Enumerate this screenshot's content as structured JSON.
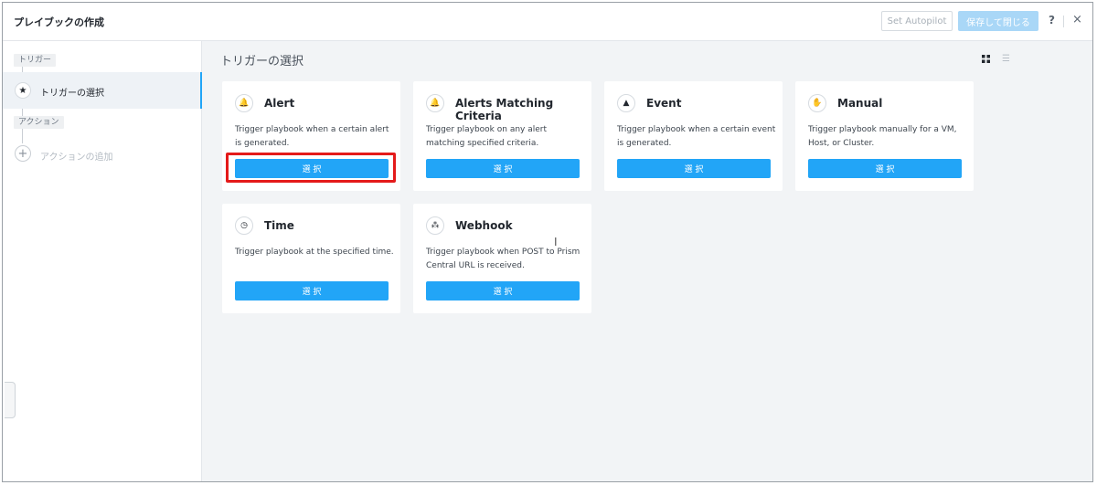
{
  "header": {
    "title": "プレイブックの作成",
    "autopilot_label": "Set Autopilot",
    "save_close_label": "保存して閉じる",
    "help_label": "?",
    "close_label": "×"
  },
  "sidebar": {
    "trigger_tag": "トリガー",
    "trigger_step_label": "トリガーの選択",
    "action_tag": "アクション",
    "add_action_label": "アクションの追加"
  },
  "main": {
    "title": "トリガーの選択",
    "cards": [
      {
        "title": "Alert",
        "icon": "bell-icon",
        "glyph": "🔔",
        "desc": "Trigger playbook when a certain alert is generated.",
        "button": "選 択"
      },
      {
        "title": "Alerts Matching Criteria",
        "icon": "bell-icon",
        "glyph": "🔔",
        "desc": "Trigger playbook on any alert matching specified criteria.",
        "button": "選 択"
      },
      {
        "title": "Event",
        "icon": "triangle-icon",
        "glyph": "▲",
        "desc": "Trigger playbook when a certain event is generated.",
        "button": "選 択"
      },
      {
        "title": "Manual",
        "icon": "hand-icon",
        "glyph": "✋",
        "desc": "Trigger playbook manually for a VM, Host, or Cluster.",
        "button": "選 択"
      },
      {
        "title": "Time",
        "icon": "clock-icon",
        "glyph": "◷",
        "desc": "Trigger playbook at the specified time.",
        "button": "選 択"
      },
      {
        "title": "Webhook",
        "icon": "webhook-icon",
        "glyph": "⁂",
        "desc": "Trigger playbook when POST to Prism Central URL is received.",
        "button": "選 択"
      }
    ]
  },
  "colors": {
    "accent": "#22a5f7",
    "highlight": "#e41a1a",
    "panel_bg": "#f2f4f6"
  }
}
